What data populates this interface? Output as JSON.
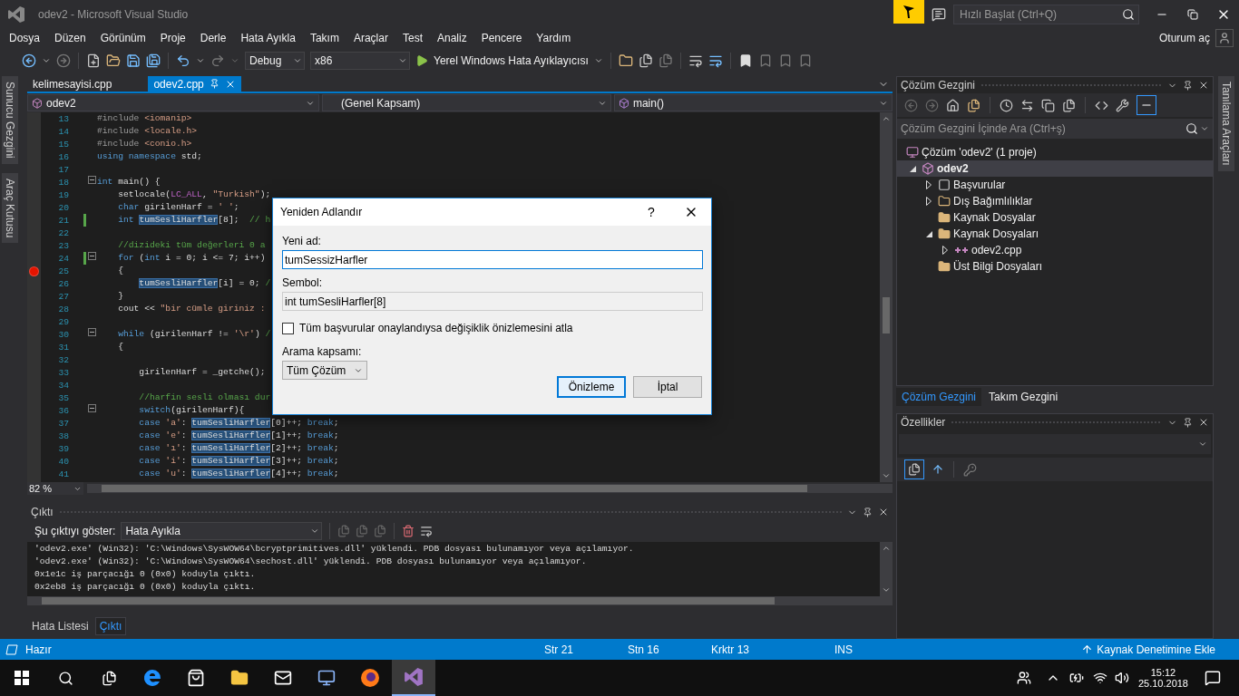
{
  "window": {
    "title": "odev2 - Microsoft Visual Studio"
  },
  "quick_launch": {
    "placeholder": "Hızlı Başlat (Ctrl+Q)"
  },
  "menu": [
    "Dosya",
    "Düzen",
    "Görünüm",
    "Proje",
    "Derle",
    "Hata Ayıkla",
    "Takım",
    "Araçlar",
    "Test",
    "Analiz",
    "Pencere",
    "Yardım"
  ],
  "sign_in": "Oturum aç",
  "toolbar": {
    "configuration": "Debug",
    "platform": "x86",
    "debugger": "Yerel Windows Hata Ayıklayıcısı"
  },
  "left_tabs": [
    "Sunucu Gezgini",
    "Araç Kutusu"
  ],
  "right_tabs": [
    "Tanılama Araçları"
  ],
  "editor": {
    "tabs": [
      {
        "label": "kelimesayisi.cpp",
        "selected": false
      },
      {
        "label": "odev2.cpp",
        "selected": true
      }
    ],
    "nav": {
      "project": "odev2",
      "scope": "(Genel Kapsam)",
      "member": "main()"
    },
    "zoom": "82 %",
    "lines": [
      {
        "n": "13",
        "breakpoint": false,
        "changed": false,
        "foldable": false,
        "segs": [
          {
            "text": "#include",
            "kind": "pre"
          },
          {
            "text": " <iomanip>",
            "kind": "str"
          }
        ]
      },
      {
        "n": "14",
        "breakpoint": false,
        "changed": false,
        "foldable": false,
        "segs": [
          {
            "text": "#include",
            "kind": "pre"
          },
          {
            "text": " <locale.h>",
            "kind": "str"
          }
        ]
      },
      {
        "n": "15",
        "breakpoint": false,
        "changed": false,
        "foldable": false,
        "segs": [
          {
            "text": "#include",
            "kind": "pre"
          },
          {
            "text": " <conio.h>",
            "kind": "str"
          }
        ]
      },
      {
        "n": "16",
        "breakpoint": false,
        "changed": false,
        "foldable": false,
        "segs": [
          {
            "text": "using namespace",
            "kind": "kw"
          },
          {
            "text": " std;",
            "kind": "plain"
          }
        ]
      },
      {
        "n": "17",
        "breakpoint": false,
        "changed": false,
        "foldable": false
      },
      {
        "n": "18",
        "breakpoint": false,
        "changed": false,
        "foldable": true,
        "segs": [
          {
            "text": "int",
            "kind": "kw"
          },
          {
            "text": " main() {",
            "kind": "plain"
          }
        ]
      },
      {
        "n": "19",
        "breakpoint": false,
        "changed": false,
        "foldable": false,
        "segs": [
          {
            "text": "    setlocale(",
            "kind": "plain"
          },
          {
            "text": "LC_ALL",
            "kind": "macro"
          },
          {
            "text": ", ",
            "kind": "plain"
          },
          {
            "text": "\"Turkish\"",
            "kind": "str"
          },
          {
            "text": ");",
            "kind": "plain"
          }
        ]
      },
      {
        "n": "20",
        "breakpoint": false,
        "changed": false,
        "foldable": false,
        "segs": [
          {
            "text": "    char",
            "kind": "kw"
          },
          {
            "text": " girilenHarf = ",
            "kind": "plain"
          },
          {
            "text": "' '",
            "kind": "str"
          },
          {
            "text": ";",
            "kind": "plain"
          }
        ]
      },
      {
        "n": "21",
        "breakpoint": false,
        "changed": true,
        "foldable": false,
        "segs": [
          {
            "text": "    int ",
            "kind": "kw"
          },
          {
            "text": "tumSesliHarfler",
            "kind": "ref"
          },
          {
            "text": "[8];  ",
            "kind": "plain"
          },
          {
            "text": "// h",
            "kind": "cmt"
          }
        ]
      },
      {
        "n": "22",
        "breakpoint": false,
        "changed": false,
        "foldable": false
      },
      {
        "n": "23",
        "breakpoint": false,
        "changed": false,
        "foldable": false,
        "segs": [
          {
            "text": "    //dizideki tüm değerleri 0 a",
            "kind": "cmt"
          }
        ]
      },
      {
        "n": "24",
        "breakpoint": false,
        "changed": true,
        "foldable": true,
        "segs": [
          {
            "text": "    for",
            "kind": "kw"
          },
          {
            "text": " (",
            "kind": "plain"
          },
          {
            "text": "int",
            "kind": "kw"
          },
          {
            "text": " i = 0; i <= 7; i++)",
            "kind": "plain"
          }
        ]
      },
      {
        "n": "25",
        "breakpoint": true,
        "changed": false,
        "foldable": false,
        "segs": [
          {
            "text": "    {",
            "kind": "plain"
          }
        ]
      },
      {
        "n": "26",
        "breakpoint": false,
        "changed": false,
        "foldable": false,
        "segs": [
          {
            "text": "        tumSesliHarfler",
            "kind": "ref"
          },
          {
            "text": "[i] = 0; ",
            "kind": "plain"
          },
          {
            "text": "/",
            "kind": "cmt"
          }
        ]
      },
      {
        "n": "27",
        "breakpoint": false,
        "changed": false,
        "foldable": false,
        "segs": [
          {
            "text": "    }",
            "kind": "plain"
          }
        ]
      },
      {
        "n": "28",
        "breakpoint": false,
        "changed": false,
        "foldable": false,
        "segs": [
          {
            "text": "    cout << ",
            "kind": "plain"
          },
          {
            "text": "\"bir cümle giriniz :",
            "kind": "str"
          }
        ]
      },
      {
        "n": "29",
        "breakpoint": false,
        "changed": false,
        "foldable": false
      },
      {
        "n": "30",
        "breakpoint": false,
        "changed": false,
        "foldable": true,
        "segs": [
          {
            "text": "    while",
            "kind": "kw"
          },
          {
            "text": " (girilenHarf != ",
            "kind": "plain"
          },
          {
            "text": "'\\r'",
            "kind": "str"
          },
          {
            "text": ") ",
            "kind": "plain"
          },
          {
            "text": "/",
            "kind": "cmt"
          }
        ]
      },
      {
        "n": "31",
        "breakpoint": false,
        "changed": false,
        "foldable": false,
        "segs": [
          {
            "text": "    {",
            "kind": "plain"
          }
        ]
      },
      {
        "n": "32",
        "breakpoint": false,
        "changed": false,
        "foldable": false
      },
      {
        "n": "33",
        "breakpoint": false,
        "changed": false,
        "foldable": false,
        "segs": [
          {
            "text": "        girilenHarf = _getche();",
            "kind": "plain"
          }
        ]
      },
      {
        "n": "34",
        "breakpoint": false,
        "changed": false,
        "foldable": false
      },
      {
        "n": "35",
        "breakpoint": false,
        "changed": false,
        "foldable": false,
        "segs": [
          {
            "text": "        //harfin sesli olması dur",
            "kind": "cmt"
          }
        ]
      },
      {
        "n": "36",
        "breakpoint": false,
        "changed": false,
        "foldable": true,
        "segs": [
          {
            "text": "        switch",
            "kind": "kw"
          },
          {
            "text": "(girilenHarf){",
            "kind": "plain"
          }
        ]
      },
      {
        "n": "37",
        "breakpoint": false,
        "changed": false,
        "foldable": false,
        "segs": [
          {
            "text": "        case ",
            "kind": "kw"
          },
          {
            "text": "'a'",
            "kind": "str"
          },
          {
            "text": ": ",
            "kind": "plain"
          },
          {
            "text": "tumSesliHarfler",
            "kind": "ref"
          },
          {
            "text": "[0]++; ",
            "kind": "plain"
          },
          {
            "text": "break",
            "kind": "kw"
          },
          {
            "text": ";",
            "kind": "plain"
          }
        ]
      },
      {
        "n": "38",
        "breakpoint": false,
        "changed": false,
        "foldable": false,
        "segs": [
          {
            "text": "        case ",
            "kind": "kw"
          },
          {
            "text": "'e'",
            "kind": "str"
          },
          {
            "text": ": ",
            "kind": "plain"
          },
          {
            "text": "tumSesliHarfler",
            "kind": "ref"
          },
          {
            "text": "[1]++; ",
            "kind": "plain"
          },
          {
            "text": "break",
            "kind": "kw"
          },
          {
            "text": ";",
            "kind": "plain"
          }
        ]
      },
      {
        "n": "39",
        "breakpoint": false,
        "changed": false,
        "foldable": false,
        "segs": [
          {
            "text": "        case ",
            "kind": "kw"
          },
          {
            "text": "'ı'",
            "kind": "str"
          },
          {
            "text": ": ",
            "kind": "plain"
          },
          {
            "text": "tumSesliHarfler",
            "kind": "ref"
          },
          {
            "text": "[2]++; ",
            "kind": "plain"
          },
          {
            "text": "break",
            "kind": "kw"
          },
          {
            "text": ";",
            "kind": "plain"
          }
        ]
      },
      {
        "n": "40",
        "breakpoint": false,
        "changed": false,
        "foldable": false,
        "segs": [
          {
            "text": "        case ",
            "kind": "kw"
          },
          {
            "text": "'i'",
            "kind": "str"
          },
          {
            "text": ": ",
            "kind": "plain"
          },
          {
            "text": "tumSesliHarfler",
            "kind": "ref"
          },
          {
            "text": "[3]++; ",
            "kind": "plain"
          },
          {
            "text": "break",
            "kind": "kw"
          },
          {
            "text": ";",
            "kind": "plain"
          }
        ]
      },
      {
        "n": "41",
        "breakpoint": false,
        "changed": false,
        "foldable": false,
        "segs": [
          {
            "text": "        case ",
            "kind": "kw"
          },
          {
            "text": "'u'",
            "kind": "str"
          },
          {
            "text": ": ",
            "kind": "plain"
          },
          {
            "text": "tumSesliHarfler",
            "kind": "ref"
          },
          {
            "text": "[4]++; ",
            "kind": "plain"
          },
          {
            "text": "break",
            "kind": "kw"
          },
          {
            "text": ";",
            "kind": "plain"
          }
        ]
      }
    ]
  },
  "dialog": {
    "title": "Yeniden Adlandır",
    "help": "?",
    "new_name_label": "Yeni ad:",
    "new_name": "tumSessizHarfler",
    "symbol_label": "Sembol:",
    "symbol": "int tumSesliHarfler[8]",
    "skip_preview": {
      "label": "Tüm başvurular onaylandıysa değişiklik önizlemesini atla",
      "checked": false
    },
    "scope_label": "Arama kapsamı:",
    "scope": "Tüm Çözüm",
    "buttons": [
      {
        "label": "Önizleme",
        "default": true
      },
      {
        "label": "İptal",
        "default": false
      }
    ]
  },
  "output": {
    "title": "Çıktı",
    "show_label": "Şu çıktıyı göster:",
    "source": "Hata Ayıkla",
    "lines": [
      "'odev2.exe' (Win32): 'C:\\Windows\\SysWOW64\\bcryptprimitives.dll' yüklendi. PDB dosyası bulunamıyor veya açılamıyor.",
      "'odev2.exe' (Win32): 'C:\\Windows\\SysWOW64\\sechost.dll' yüklendi. PDB dosyası bulunamıyor veya açılamıyor.",
      "0x1e1c iş parçacığı 0 (0x0) koduyla çıktı.",
      "0x2eb8 iş parçacığı 0 (0x0) koduyla çıktı."
    ],
    "tabs": [
      {
        "label": "Hata Listesi",
        "selected": false
      },
      {
        "label": "Çıktı",
        "selected": true
      }
    ]
  },
  "solution_explorer": {
    "title": "Çözüm Gezgini",
    "search": {
      "placeholder": "Çözüm Gezgini İçinde Ara (Ctrl+ş)"
    },
    "tree": [
      {
        "label": "Çözüm 'odev2' (1 proje)",
        "kind": "solution",
        "selected": false,
        "children": [
          {
            "label": "odev2",
            "kind": "project",
            "selected": true,
            "expanded": true,
            "children": [
              {
                "label": "Başvurular",
                "kind": "references",
                "selected": false,
                "expanded": false
              },
              {
                "label": "Dış Bağımlılıklar",
                "kind": "external",
                "selected": false,
                "expanded": false
              },
              {
                "label": "Kaynak Dosyalar",
                "kind": "folder",
                "selected": false
              },
              {
                "label": "Kaynak Dosyaları",
                "kind": "folder",
                "selected": false,
                "expanded": true,
                "children": [
                  {
                    "label": "odev2.cpp",
                    "kind": "cpp",
                    "selected": false,
                    "expanded": false
                  }
                ]
              },
              {
                "label": "Üst Bilgi Dosyaları",
                "kind": "folder",
                "selected": false
              }
            ]
          }
        ]
      }
    ],
    "tabs": [
      {
        "label": "Çözüm Gezgini",
        "selected": true
      },
      {
        "label": "Takım Gezgini",
        "selected": false
      }
    ]
  },
  "properties": {
    "title": "Özellikler"
  },
  "status_bar": {
    "state": "Hazır",
    "line": "Str 21",
    "column": "Stn 16",
    "char": "Krktr 13",
    "mode": "INS",
    "source_control": "Kaynak Denetimine Ekle"
  },
  "taskbar": {
    "time": "15:12",
    "date": "25.10.2018"
  }
}
